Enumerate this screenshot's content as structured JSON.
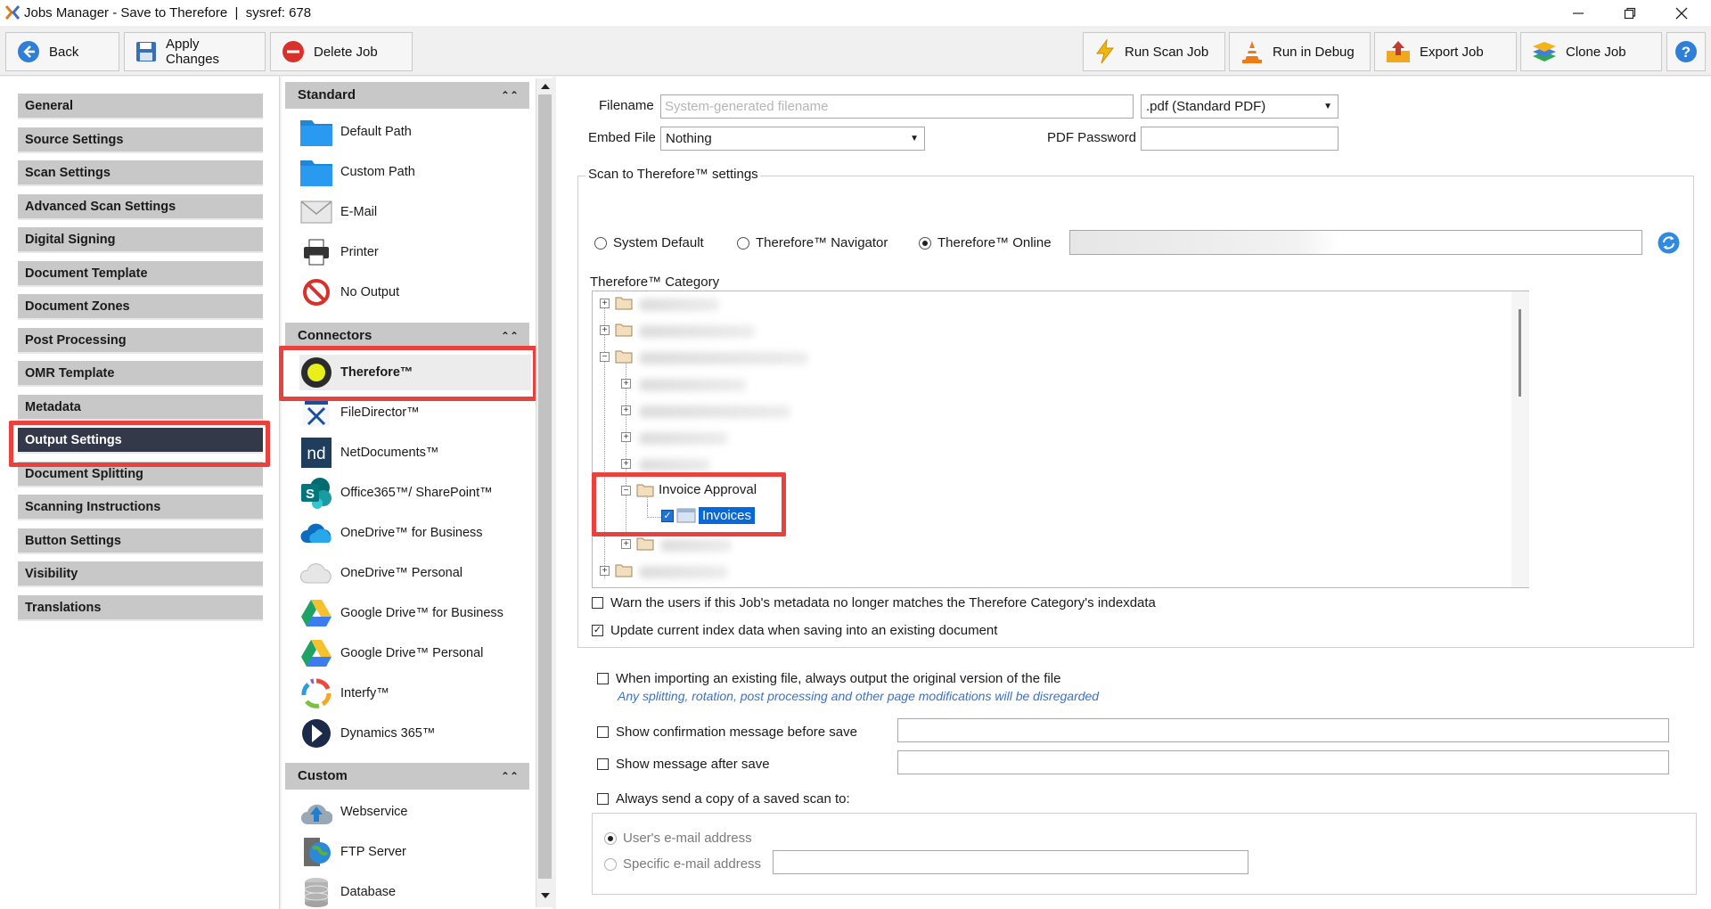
{
  "window": {
    "title": "Jobs Manager - Save to Therefore  |  sysref: 678"
  },
  "toolbar": {
    "back": "Back",
    "apply": "Apply Changes",
    "delete": "Delete Job",
    "run_scan": "Run Scan Job",
    "run_debug": "Run in Debug",
    "export": "Export Job",
    "clone": "Clone Job"
  },
  "sidebar": {
    "items": [
      "General",
      "Source Settings",
      "Scan Settings",
      "Advanced Scan Settings",
      "Digital Signing",
      "Document Template",
      "Document Zones",
      "Post Processing",
      "OMR Template",
      "Metadata",
      "Output Settings",
      "Document Splitting",
      "Scanning Instructions",
      "Button Settings",
      "Visibility",
      "Translations"
    ],
    "active": "Output Settings"
  },
  "output_panel": {
    "standard": {
      "title": "Standard",
      "items": [
        "Default Path",
        "Custom Path",
        "E-Mail",
        "Printer",
        "No Output"
      ]
    },
    "connectors": {
      "title": "Connectors",
      "items": [
        "Therefore™",
        "FileDirector™",
        "NetDocuments™",
        "Office365™/ SharePoint™",
        "OneDrive™ for Business",
        "OneDrive™ Personal",
        "Google Drive™ for Business",
        "Google Drive™ Personal",
        "Interfy™",
        "Dynamics 365™"
      ],
      "selected": "Therefore™"
    },
    "custom": {
      "title": "Custom",
      "items": [
        "Webservice",
        "FTP Server",
        "Database"
      ]
    }
  },
  "settings": {
    "filename_label": "Filename",
    "filename_placeholder": "System-generated filename",
    "format_value": ".pdf (Standard PDF)",
    "embed_label": "Embed File",
    "embed_value": "Nothing",
    "pdf_password_label": "PDF Password",
    "group_title": "Scan to Therefore™ settings",
    "radio_system": "System Default",
    "radio_navigator": "Therefore™ Navigator",
    "radio_online": "Therefore™ Online",
    "category_label": "Therefore™ Category",
    "tree_invoice_approval": "Invoice Approval",
    "tree_invoices": "Invoices",
    "warn_label": "Warn the users if this Job's metadata no longer matches the Therefore Category's indexdata",
    "update_label": "Update current index data when saving into an existing document",
    "import_label": "When importing an existing file, always output the original version of the file",
    "import_note": "Any splitting, rotation, post processing and other page modifications will be disregarded",
    "confirm_label": "Show confirmation message before save",
    "after_label": "Show message after save",
    "copy_label": "Always send a copy of a saved scan to:",
    "user_email": "User's e-mail address",
    "specific_email": "Specific e-mail address"
  },
  "colors": {
    "highlight": "#e8413e",
    "nav_active": "#34394a",
    "selection": "#0a67d6"
  }
}
